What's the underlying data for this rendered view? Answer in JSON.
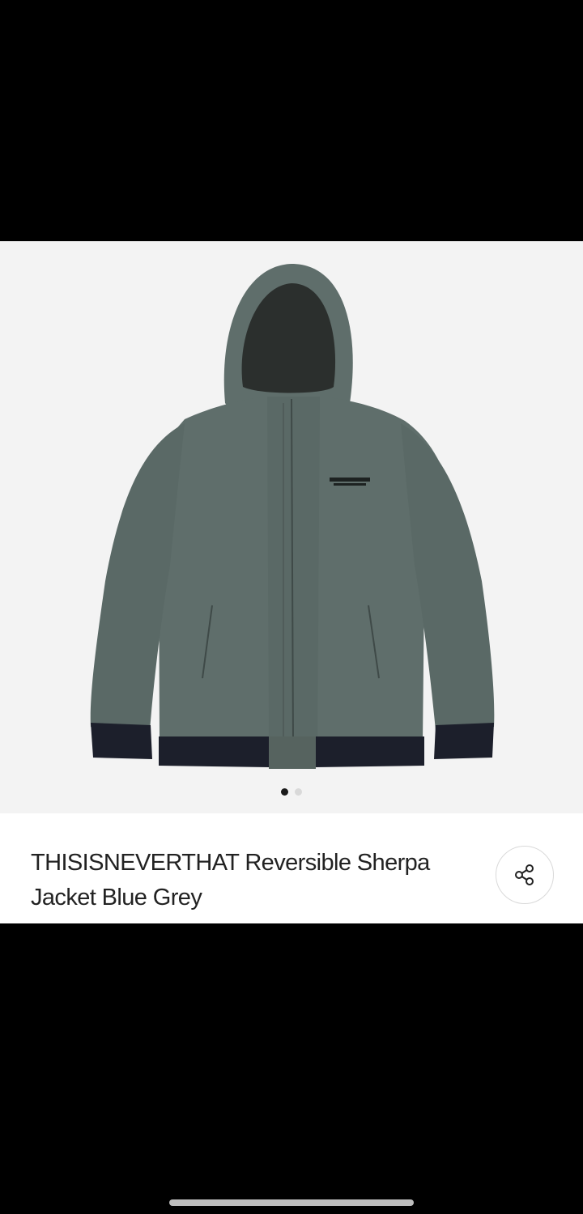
{
  "product": {
    "title": "THISISNEVERTHAT Reversible Sherpa Jacket Blue Grey",
    "image_alt": "Blue grey hooded jacket with dark navy ribbed hem"
  },
  "gallery": {
    "image_count": 2,
    "active_index": 0
  },
  "icons": {
    "share": "share-icon"
  },
  "colors": {
    "jacket": "#5f6e6b",
    "rib": "#1c1f2b",
    "gallery_bg": "#f3f3f3",
    "active_dot": "#1a1a1a",
    "inactive_dot": "#d9d9d9"
  }
}
